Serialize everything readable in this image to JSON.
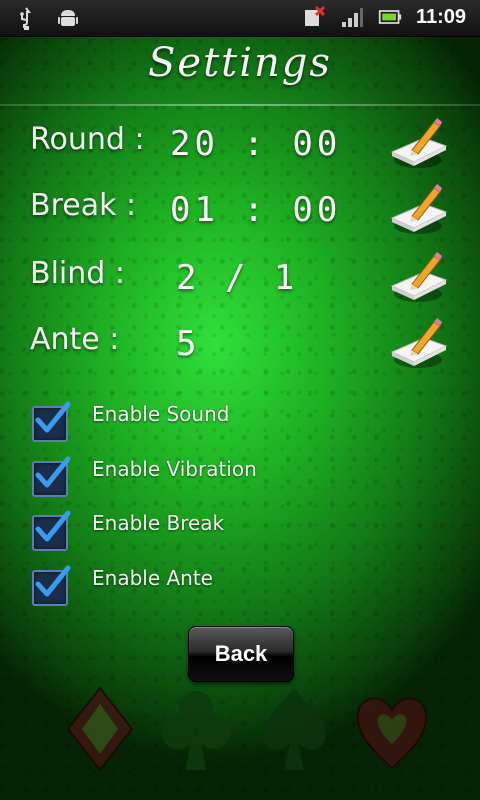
{
  "status_bar": {
    "time": "11:09",
    "icons": [
      "usb-icon",
      "android-debug-icon",
      "sim-error-icon",
      "signal-icon",
      "battery-icon"
    ]
  },
  "page": {
    "title": "Settings"
  },
  "timers": [
    {
      "label": "Round :",
      "value": "20 : 00",
      "edit_icon": "pencil-edit-icon"
    },
    {
      "label": "Break :",
      "value": "01 : 00",
      "edit_icon": "pencil-edit-icon"
    },
    {
      "label": "Blind :",
      "value": "2 / 1",
      "edit_icon": "pencil-edit-icon"
    },
    {
      "label": "Ante :",
      "value": "5",
      "edit_icon": "pencil-edit-icon"
    }
  ],
  "options": [
    {
      "label": "Enable Sound",
      "checked": true
    },
    {
      "label": "Enable Vibration",
      "checked": true
    },
    {
      "label": "Enable Break",
      "checked": true
    },
    {
      "label": "Enable Ante",
      "checked": true
    }
  ],
  "back_label": "Back",
  "suits": [
    "diamond-icon",
    "club-icon",
    "spade-icon",
    "heart-icon"
  ],
  "colors": {
    "felt": "#1eae22",
    "checkbox": "#1a2d4a",
    "check_mark": "#3a9cf0"
  }
}
